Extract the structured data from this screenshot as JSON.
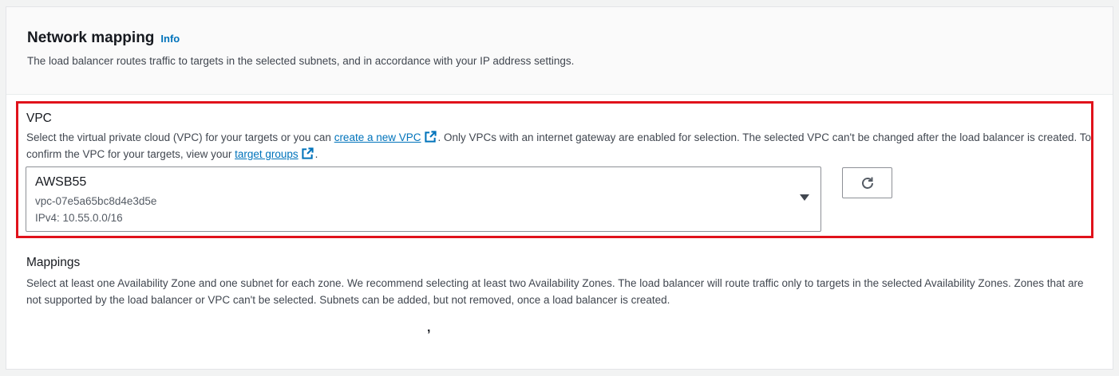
{
  "section": {
    "title": "Network mapping",
    "info_label": "Info",
    "subtitle": "The load balancer routes traffic to targets in the selected subnets, and in accordance with your IP address settings."
  },
  "vpc": {
    "label": "VPC",
    "desc_part1": "Select the virtual private cloud (VPC) for your targets or you can ",
    "create_link": "create a new VPC",
    "desc_part2": ". Only VPCs with an internet gateway are enabled for selection. The selected VPC can't be changed after the load balancer is created. To confirm the VPC for your targets, view your ",
    "target_groups_link": "target groups",
    "desc_part3": ".",
    "selected": {
      "name": "AWSB55",
      "id": "vpc-07e5a65bc8d4e3d5e",
      "cidr": "IPv4: 10.55.0.0/16"
    },
    "refresh_icon": "refresh-icon"
  },
  "mappings": {
    "label": "Mappings",
    "desc": "Select at least one Availability Zone and one subnet for each zone. We recommend selecting at least two Availability Zones. The load balancer will route traffic only to targets in the selected Availability Zones. Zones that are not supported by the load balancer or VPC can't be selected. Subnets can be added, but not removed, once a load balancer is created."
  },
  "stray_mark": ","
}
